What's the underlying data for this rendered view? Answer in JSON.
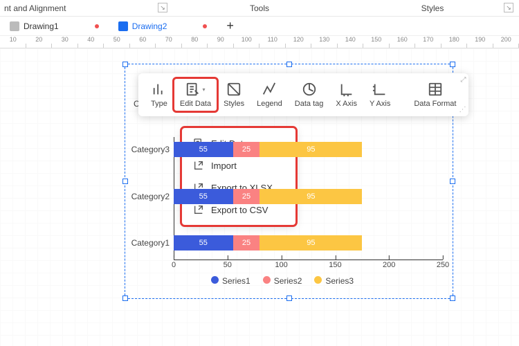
{
  "ribbon": {
    "groups": [
      "nt and Alignment",
      "Tools",
      "Styles"
    ]
  },
  "tabs": {
    "items": [
      {
        "label": "Drawing1",
        "modified": true,
        "active": false
      },
      {
        "label": "Drawing2",
        "modified": true,
        "active": true
      }
    ],
    "add_tooltip": "+"
  },
  "ruler": {
    "ticks": [
      "10",
      "20",
      "30",
      "40",
      "50",
      "60",
      "70",
      "80",
      "90",
      "100",
      "110",
      "120",
      "130",
      "140",
      "150",
      "160",
      "170",
      "180",
      "190",
      "200"
    ]
  },
  "chart_toolbar": {
    "buttons": [
      "Type",
      "Edit Data",
      "Styles",
      "Legend",
      "Data tag",
      "X Axis",
      "Y Axis",
      "Data Format"
    ],
    "highlighted_index": 1
  },
  "edit_data_menu": {
    "items": [
      "Edit Data",
      "Import",
      "Export to XLSX",
      "Export to CSV"
    ]
  },
  "chart_data": {
    "type": "bar",
    "orientation": "horizontal",
    "stacked": true,
    "categories": [
      "Category1",
      "Category2",
      "Category3"
    ],
    "series": [
      {
        "name": "Series1",
        "color": "#3b5bdb",
        "values": [
          55,
          55,
          55
        ]
      },
      {
        "name": "Series2",
        "color": "#fa8282",
        "values": [
          25,
          25,
          25
        ]
      },
      {
        "name": "Series3",
        "color": "#fcc643",
        "values": [
          95,
          95,
          95
        ]
      }
    ],
    "xlim": [
      0,
      250
    ],
    "x_ticks": [
      0,
      50,
      100,
      150,
      200,
      250
    ],
    "title": "",
    "xlabel": "",
    "ylabel": ""
  },
  "misc": {
    "letter_C": "C"
  }
}
